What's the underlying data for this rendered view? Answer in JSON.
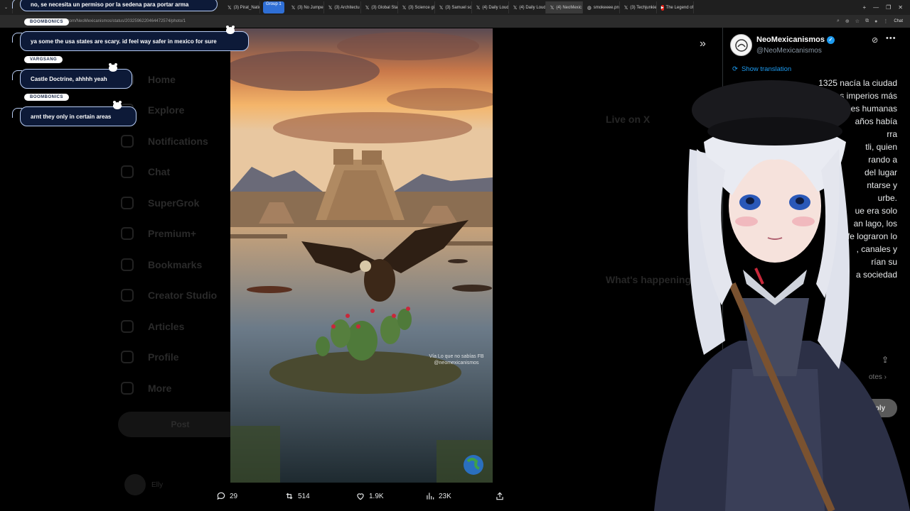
{
  "browser": {
    "tabs": [
      {
        "label": "(3) Pirat_Nation",
        "icon": "x-icon"
      },
      {
        "label": "Group 1",
        "group": true
      },
      {
        "label": "(3) No Jumper",
        "icon": "x-icon"
      },
      {
        "label": "(3) Architectu",
        "icon": "x-icon"
      },
      {
        "label": "(3) Global Stati",
        "icon": "x-icon"
      },
      {
        "label": "(3) Science girl",
        "icon": "x-icon"
      },
      {
        "label": "(3) Samuel so",
        "icon": "x-icon"
      },
      {
        "label": "(4) Daily Loud",
        "icon": "x-icon"
      },
      {
        "label": "(4) Daily Loud",
        "icon": "x-icon"
      },
      {
        "label": "(4) NeoMexic",
        "icon": "x-icon",
        "active": true
      },
      {
        "label": "smokeeee.png",
        "icon": "globe-icon"
      },
      {
        "label": "(3) Techjunkie",
        "icon": "x-icon"
      },
      {
        "label": "The Legend of",
        "icon": "youtube-icon"
      }
    ],
    "url": "x.com/NeoMexicanismos/status/2032596220464472574/photo/1",
    "chat_label": "Chat"
  },
  "chat": [
    {
      "user": "",
      "text": "no, se necesita un permiso por la sedena para portar arma"
    },
    {
      "user": "BOOMBONICS",
      "text": "ya some the usa states are scary. id feel way safer in mexico for sure"
    },
    {
      "user": "VARGSANG",
      "text": "Castle Doctrine, ahhhh yeah"
    },
    {
      "user": "BOOMBONICS",
      "text": "arnt they only in certain areas"
    }
  ],
  "x_nav": [
    "Home",
    "Explore",
    "Notifications",
    "Chat",
    "SuperGrok",
    "Premium+",
    "Bookmarks",
    "Creator Studio",
    "Articles",
    "Profile",
    "More"
  ],
  "x_post_label": "Post",
  "bg_user": "Elly",
  "bg_side": {
    "live_heading": "Live on X",
    "happening_heading": "What's happening"
  },
  "photo": {
    "watermark_line1": "Vía Lo que no sabías FB",
    "watermark_line2": "@neomexicanismos"
  },
  "actions": {
    "replies": "29",
    "reposts": "514",
    "likes": "1.9K",
    "views": "23K"
  },
  "tweet": {
    "author": "NeoMexicanismos",
    "handle": "@NeoMexicanismos",
    "show_translation": "Show translation",
    "lines": [
      "1325 nacía la ciudad",
      "es imperios más",
      "es humanas",
      "años había",
      "rra",
      "tli, quien",
      "rando a",
      "del lugar",
      "ntarse y",
      "urbe.",
      "ue era solo",
      "an lago, los",
      "fe lograron lo",
      ", canales y",
      "rían su",
      "a sociedad"
    ],
    "quotes_label": "otes",
    "reply_label": "ply"
  }
}
